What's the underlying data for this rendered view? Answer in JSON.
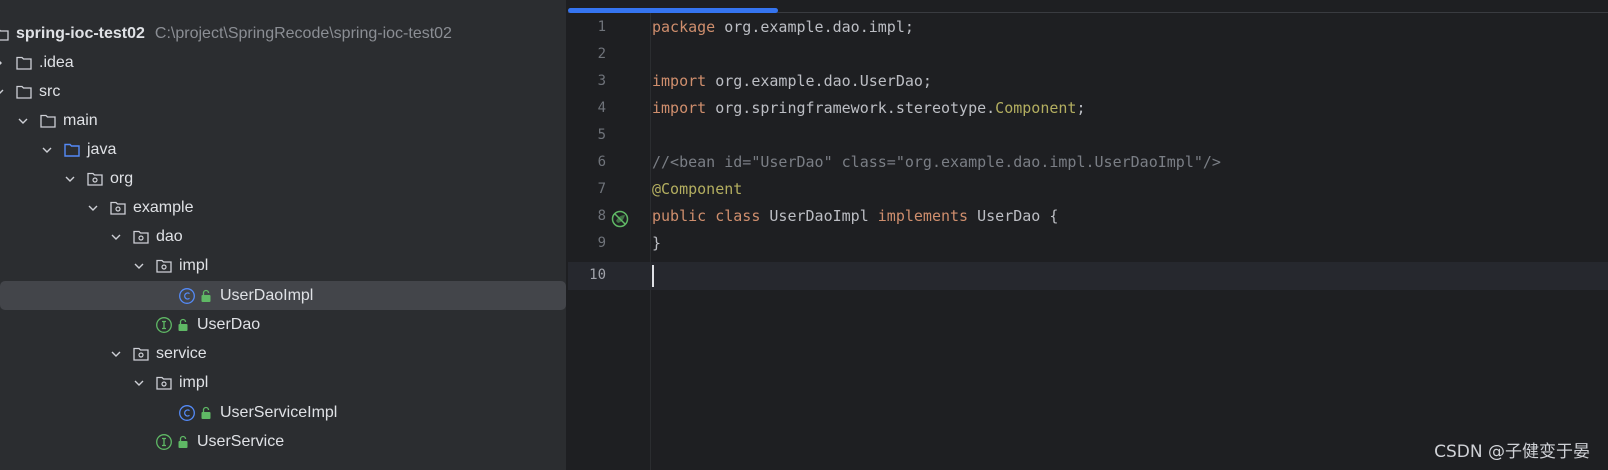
{
  "project_tree": {
    "root": {
      "name": "spring-ioc-test02",
      "path": "C:\\project\\SpringRecode\\spring-ioc-test02"
    },
    "items": [
      {
        "label": ".idea"
      },
      {
        "label": "src"
      },
      {
        "label": "main"
      },
      {
        "label": "java"
      },
      {
        "label": "org"
      },
      {
        "label": "example"
      },
      {
        "label": "dao"
      },
      {
        "label": "impl"
      },
      {
        "label": "UserDaoImpl",
        "selected": true
      },
      {
        "label": "UserDao"
      },
      {
        "label": "service"
      },
      {
        "label": "impl"
      },
      {
        "label": "UserServiceImpl"
      },
      {
        "label": "UserService"
      }
    ]
  },
  "editor": {
    "line_numbers": [
      "1",
      "2",
      "3",
      "4",
      "5",
      "6",
      "7",
      "8",
      "9",
      "10"
    ],
    "current_line": "10",
    "lines": [
      {
        "kw": "package",
        "text": " org.example.dao.impl;"
      },
      {
        "text": ""
      },
      {
        "kw": "import",
        "text": " org.example.dao.UserDao;"
      },
      {
        "kw": "import",
        "text": " org.springframework.stereotype.",
        "ann": "Component",
        "tail": ";"
      },
      {
        "text": ""
      },
      {
        "comment": "//<bean id=\"UserDao\" class=\"org.example.dao.impl.UserDaoImpl\"/>"
      },
      {
        "ann": "@Component"
      },
      {
        "kw1": "public",
        "kw2": "class",
        "name": "UserDaoImpl",
        "kw3": "implements",
        "iface": "UserDao {"
      },
      {
        "text": "}"
      },
      {
        "text": ""
      }
    ]
  },
  "watermark": "CSDN @子健变于晏",
  "colors": {
    "accent": "#3574f0",
    "keyword": "#cf8e6d",
    "annotation": "#b3ae60",
    "comment": "#7a7e85",
    "class_icon": "#548af7",
    "interface_icon": "#5fb865"
  }
}
